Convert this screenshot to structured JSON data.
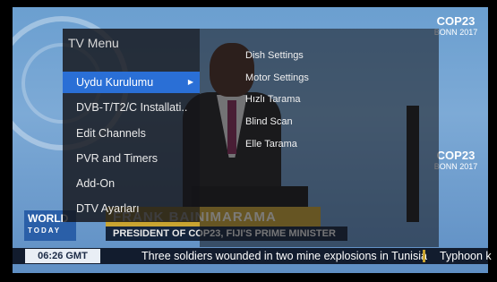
{
  "menu": {
    "title": "TV Menu",
    "items": [
      {
        "label": "Uydu Kurulumu",
        "selected": true
      },
      {
        "label": "DVB-T/T2/C Installati.."
      },
      {
        "label": "Edit Channels"
      },
      {
        "label": "PVR and Timers"
      },
      {
        "label": "Add-On"
      },
      {
        "label": "DTV Ayarları"
      }
    ],
    "submenu_arrow_icon": "triangle-right-icon"
  },
  "submenu": {
    "items": [
      {
        "label": "Dish Settings"
      },
      {
        "label": "Motor Settings"
      },
      {
        "label": "Hızlı Tarama"
      },
      {
        "label": "Blind Scan"
      },
      {
        "label": "Elle Tarama"
      }
    ]
  },
  "broadcast": {
    "channel_logo_line1": "WORLD",
    "channel_logo_line2": "TODAY",
    "lower_third_name": "FRANK BAINIMARAMA",
    "lower_third_role": "PRESIDENT OF COP23, FIJI'S PRIME MINISTER",
    "clock": "06:26 GMT",
    "ticker_headline": "Three soldiers wounded in two mine explosions in Tunisia",
    "ticker_next": "Typhoon k",
    "cop_logo_title": "COP23",
    "cop_logo_city": "BONN 2017",
    "accent_color": "#2a6fd6"
  }
}
